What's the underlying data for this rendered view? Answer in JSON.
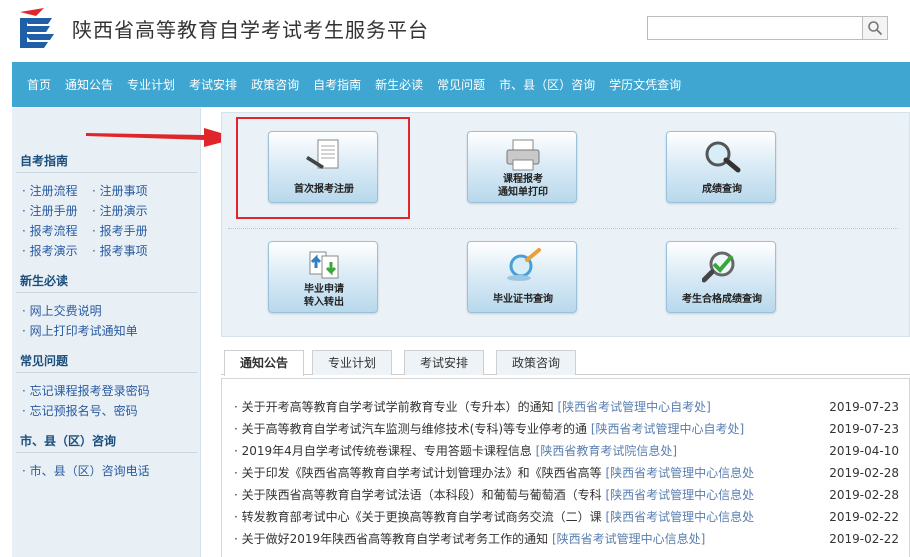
{
  "header": {
    "title": "陕西省高等教育自学考试考生服务平台",
    "search_placeholder": ""
  },
  "nav": [
    "首页",
    "通知公告",
    "专业计划",
    "考试安排",
    "政策咨询",
    "自考指南",
    "新生必读",
    "常见问题",
    "市、县（区）咨询",
    "学历文凭查询"
  ],
  "sidebar": {
    "sections": [
      {
        "title": "自考指南",
        "links": [
          "注册流程",
          "注册事项",
          "注册手册",
          "注册演示",
          "报考流程",
          "报考手册",
          "报考演示",
          "报考事项"
        ]
      },
      {
        "title": "新生必读",
        "links": [
          "网上交费说明",
          "网上打印考试通知单"
        ]
      },
      {
        "title": "常见问题",
        "links": [
          "忘记课程报考登录密码",
          "忘记预报名号、密码"
        ]
      },
      {
        "title": "市、县（区）咨询",
        "links": [
          "市、县（区）咨询电话"
        ]
      }
    ]
  },
  "tiles": [
    {
      "label": "首次报考注册",
      "icon": "register-doc-icon"
    },
    {
      "label": "课程报考",
      "label2": "通知单打印",
      "icon": "printer-icon"
    },
    {
      "label": "成绩查询",
      "icon": "magnifier-icon"
    },
    {
      "label": "毕业申请",
      "label2": "转入转出",
      "icon": "transfer-docs-icon"
    },
    {
      "label": "毕业证书查询",
      "icon": "certificate-search-icon"
    },
    {
      "label": "考生合格成绩查询",
      "icon": "qualified-search-icon"
    }
  ],
  "tabs": [
    "通知公告",
    "专业计划",
    "考试安排",
    "政策咨询"
  ],
  "news": [
    {
      "title": "关于开考高等教育自学考试学前教育专业（专升本）的通知 ",
      "source": "[陕西省考试管理中心自考处]",
      "date": "2019-07-23"
    },
    {
      "title": "关于高等教育自学考试汽车监测与维修技术(专科)等专业停考的通 ",
      "source": "[陕西省考试管理中心自考处]",
      "date": "2019-07-23"
    },
    {
      "title": "2019年4月自学考试传统卷课程、专用答题卡课程信息 ",
      "source": "[陕西省教育考试院信息处]",
      "date": "2019-04-10"
    },
    {
      "title": "关于印发《陕西省高等教育自学考试计划管理办法》和《陕西省高等 ",
      "source": "[陕西省考试管理中心信息处]",
      "date": "2019-02-28"
    },
    {
      "title": "关于陕西省高等教育自学考试法语（本科段）和葡萄与葡萄酒（专科 ",
      "source": "[陕西省考试管理中心信息处]",
      "date": "2019-02-28"
    },
    {
      "title": "转发教育部考试中心《关于更换高等教育自学考试商务交流（二）课 ",
      "source": "[陕西省考试管理中心信息处]",
      "date": "2019-02-22"
    },
    {
      "title": "关于做好2019年陕西省高等教育自学考试考务工作的通知 ",
      "source": "[陕西省考试管理中心信息处]",
      "date": "2019-02-22"
    }
  ]
}
